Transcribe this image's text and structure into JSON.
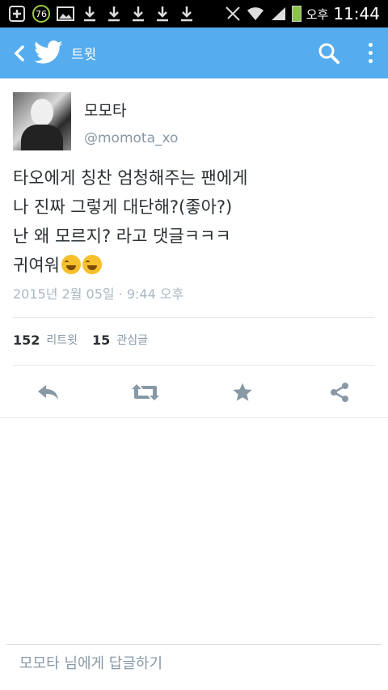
{
  "status_bar": {
    "notification_count": "76",
    "ampm": "오후",
    "time": "11:44",
    "icons": [
      "plus-icon",
      "notification-badge",
      "image-icon",
      "download-icon",
      "download-icon",
      "download-icon",
      "download-icon",
      "download-icon",
      "mute-icon",
      "wifi-icon",
      "signal-icon",
      "battery-icon"
    ]
  },
  "app_bar": {
    "title": "트윗",
    "brand_color": "#55acee",
    "icons": [
      "back-icon",
      "twitter-bird-icon",
      "search-icon",
      "more-icon"
    ]
  },
  "tweet": {
    "author_name": "모모타",
    "author_handle": "@momota_xo",
    "lines": [
      "타오에게 칭찬 엄청해주는 팬에게",
      "나 진짜 그렇게 대단해?(좋아?)",
      "난 왜 모르지? 라고 댓글ㅋㅋㅋ",
      "귀여워"
    ],
    "timestamp": "2015년 2월 05일 · 9:44 오후",
    "retweet_count": "152",
    "retweet_label": "리트윗",
    "favorite_count": "15",
    "favorite_label": "관심글"
  },
  "actions": [
    "reply-icon",
    "retweet-icon",
    "favorite-icon",
    "share-icon"
  ],
  "reply": {
    "placeholder": "모모타 님에게 답글하기"
  }
}
